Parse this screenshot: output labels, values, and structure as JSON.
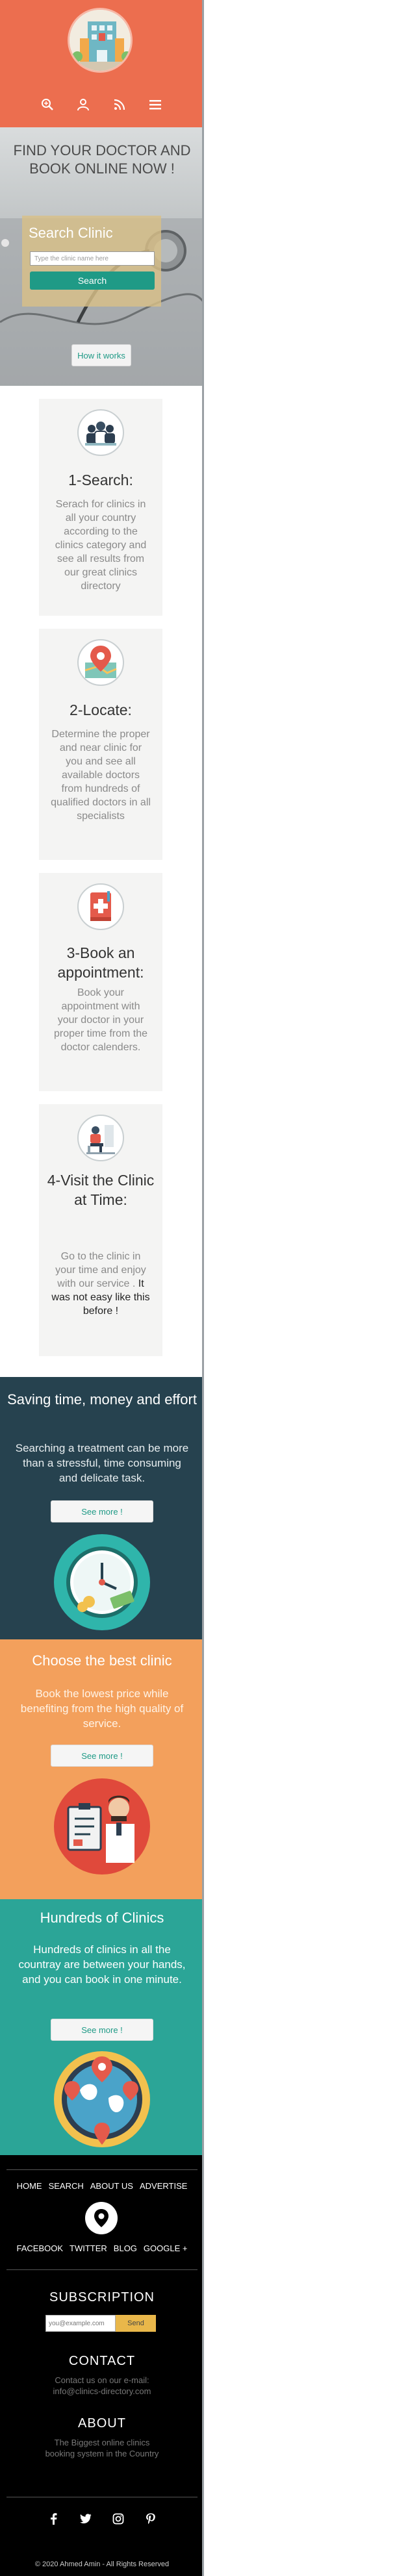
{
  "header": {
    "logo_alt": "clinics directory logo",
    "nav_icons": [
      "search-icon",
      "user-icon",
      "rss-icon",
      "menu-icon"
    ]
  },
  "hero": {
    "title": "FIND YOUR DOCTOR AND BOOK ONLINE NOW !",
    "search_heading": "Search Clinic",
    "search_placeholder": "Type the clinic name here",
    "search_button": "Search",
    "how_button": "How it works"
  },
  "steps": [
    {
      "title": "1-Search:",
      "text": "Serach for clinics in all your country according to the clinics category and see all results from our great clinics directory"
    },
    {
      "title": "2-Locate:",
      "text": "Determine the proper and near clinic for you and see all available doctors from hundreds of qualified doctors in all specialists"
    },
    {
      "title": "3-Book an appointment:",
      "text": "Book your appointment with your doctor in your proper time from the doctor calenders."
    },
    {
      "title": "4-Visit the Clinic at Time:",
      "text": "Go to the clinic in your time and enjoy with our service .",
      "text_dark": "It was not easy like this before !"
    }
  ],
  "features": [
    {
      "title": "Saving time, money and effort",
      "text": "Searching a treatment can be more than a stressful, time consuming and delicate task.",
      "button": "See more !",
      "bg": "#26424f",
      "text_color": "#e8eef0"
    },
    {
      "title": "Choose the best clinic",
      "text": "Book the lowest price while benefiting from the high quality of service.",
      "button": "See more !",
      "bg": "#f3a05c",
      "text_color": "#fff3e6"
    },
    {
      "title": "Hundreds of Clinics",
      "text": "Hundreds of clinics in all the countray are between your hands, and you can book in one minute.",
      "button": "See more !",
      "bg": "#2ba597",
      "text_color": "#ffffff"
    }
  ],
  "footer": {
    "links_top": [
      "HOME",
      "SEARCH",
      "ABOUT US",
      "ADVERTISE"
    ],
    "links_social": [
      "FACEBOOK",
      "TWITTER",
      "BLOG",
      "GOOGLE +"
    ],
    "subscription_title": "SUBSCRIPTION",
    "subscription_placeholder": "you@example.com",
    "subscription_button": "Send",
    "contact_title": "CONTACT",
    "contact_text": "Contact us on our e-mail: info@clinics-directory.com",
    "about_title": "ABOUT",
    "about_text": "The Biggest online clinics booking system in the Country",
    "social_icons": [
      "facebook-icon",
      "twitter-icon",
      "instagram-icon",
      "pinterest-icon"
    ],
    "copyright": "© 2020 Ahmed Amin - All Rights Reserved"
  },
  "colors": {
    "header_bg": "#ec6e4f",
    "accent_teal": "#1f9a86",
    "footer_bg": "#000000"
  }
}
